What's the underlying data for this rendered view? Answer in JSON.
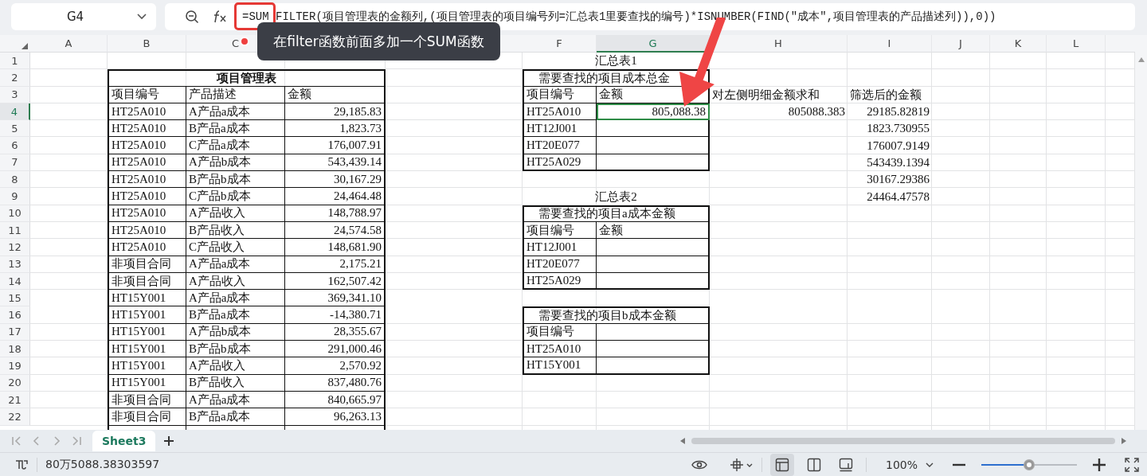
{
  "name_box": {
    "value": "G4"
  },
  "formula_bar": {
    "formula": "=SUM FILTER(项目管理表的金额列,(项目管理表的项目编号列=汇总表1里要查找的编号)*ISNUMBER(FIND(\"成本\",项目管理表的产品描述列)),0))"
  },
  "annotation": {
    "text": "在filter函数前面多加一个SUM函数"
  },
  "column_headers": [
    {
      "label": "A",
      "selected": false
    },
    {
      "label": "B",
      "selected": false
    },
    {
      "label": "C",
      "selected": false
    },
    {
      "label": "F",
      "selected": false
    },
    {
      "label": "G",
      "selected": true
    },
    {
      "label": "H",
      "selected": false
    },
    {
      "label": "I",
      "selected": false
    },
    {
      "label": "J",
      "selected": false
    },
    {
      "label": "K",
      "selected": false
    },
    {
      "label": "L",
      "selected": false
    }
  ],
  "row_headers": [
    {
      "label": "1",
      "selected": false
    },
    {
      "label": "2",
      "selected": false
    },
    {
      "label": "3",
      "selected": false
    },
    {
      "label": "4",
      "selected": true
    },
    {
      "label": "5",
      "selected": false
    },
    {
      "label": "6",
      "selected": false
    },
    {
      "label": "7",
      "selected": false
    },
    {
      "label": "8",
      "selected": false
    },
    {
      "label": "9",
      "selected": false
    },
    {
      "label": "10",
      "selected": false
    },
    {
      "label": "11",
      "selected": false
    },
    {
      "label": "12",
      "selected": false
    },
    {
      "label": "13",
      "selected": false
    },
    {
      "label": "14",
      "selected": false
    },
    {
      "label": "15",
      "selected": false
    },
    {
      "label": "16",
      "selected": false
    },
    {
      "label": "17",
      "selected": false
    },
    {
      "label": "18",
      "selected": false
    },
    {
      "label": "19",
      "selected": false
    },
    {
      "label": "20",
      "selected": false
    },
    {
      "label": "21",
      "selected": false
    },
    {
      "label": "22",
      "selected": false
    }
  ],
  "project_table": {
    "title": "项目管理表",
    "columns": [
      "项目编号",
      "产品描述",
      "金额"
    ],
    "rows": [
      [
        "HT25A010",
        "A产品a成本",
        "29,185.83"
      ],
      [
        "HT25A010",
        "B产品a成本",
        "1,823.73"
      ],
      [
        "HT25A010",
        "C产品a成本",
        "176,007.91"
      ],
      [
        "HT25A010",
        "A产品b成本",
        "543,439.14"
      ],
      [
        "HT25A010",
        "B产品b成本",
        "30,167.29"
      ],
      [
        "HT25A010",
        "C产品b成本",
        "24,464.48"
      ],
      [
        "HT25A010",
        "A产品收入",
        "148,788.97"
      ],
      [
        "HT25A010",
        "B产品收入",
        "24,574.58"
      ],
      [
        "HT25A010",
        "C产品收入",
        "148,681.90"
      ],
      [
        "非项目合同",
        "A产品a成本",
        "2,175.21"
      ],
      [
        "非项目合同",
        "A产品收入",
        "162,507.42"
      ],
      [
        "HT15Y001",
        "A产品a成本",
        "369,341.10"
      ],
      [
        "HT15Y001",
        "B产品a成本",
        "-14,380.71"
      ],
      [
        "HT15Y001",
        "A产品b成本",
        "28,355.67"
      ],
      [
        "HT15Y001",
        "B产品b成本",
        "291,000.46"
      ],
      [
        "HT15Y001",
        "A产品收入",
        "2,570.92"
      ],
      [
        "HT15Y001",
        "B产品收入",
        "837,480.76"
      ],
      [
        "非项目合同",
        "A产品a成本",
        "840,665.97"
      ],
      [
        "非项目合同",
        "B产品a成本",
        "96,263.13"
      ]
    ]
  },
  "summary_1": {
    "caption": "汇总表1",
    "title": "需要查找的项目成本总金",
    "columns": [
      "项目编号",
      "金额"
    ],
    "rows": [
      {
        "id": "HT25A010",
        "amount": "805,088.38",
        "selected": true
      },
      {
        "id": "HT12J001",
        "selected": false
      },
      {
        "id": "HT20E077",
        "selected": false
      },
      {
        "id": "HT25A029",
        "selected": false
      }
    ]
  },
  "summary_2": {
    "caption": "汇总表2",
    "title": "需要查找的项目a成本金额",
    "columns": [
      "项目编号",
      "金额"
    ],
    "rows": [
      {
        "id": "HT12J001"
      },
      {
        "id": "HT20E077"
      },
      {
        "id": "HT25A029"
      }
    ]
  },
  "summary_3": {
    "title": "需要查找的项目b成本金额",
    "columns": [
      "项目编号"
    ],
    "rows": [
      {
        "id": "HT25A010"
      },
      {
        "id": "HT15Y001"
      }
    ]
  },
  "check_sum": {
    "label": "对左侧明细金额求和",
    "value": "805088.383"
  },
  "filtered": {
    "label": "筛选后的金额",
    "values": [
      "29185.82819",
      "1823.730955",
      "176007.9149",
      "543439.1394",
      "30167.29386",
      "24464.47578"
    ]
  },
  "sheet_tabs": [
    {
      "label": "Sheet3",
      "selected": true
    }
  ],
  "status_bar": {
    "sum": "80万5088.38303597",
    "zoom": "100%",
    "zoom_slider": {
      "level": 0.5
    },
    "views": [
      {
        "kind": "normal",
        "selected": true
      },
      {
        "kind": "split",
        "selected": false
      },
      {
        "kind": "page",
        "selected": false
      }
    ]
  }
}
